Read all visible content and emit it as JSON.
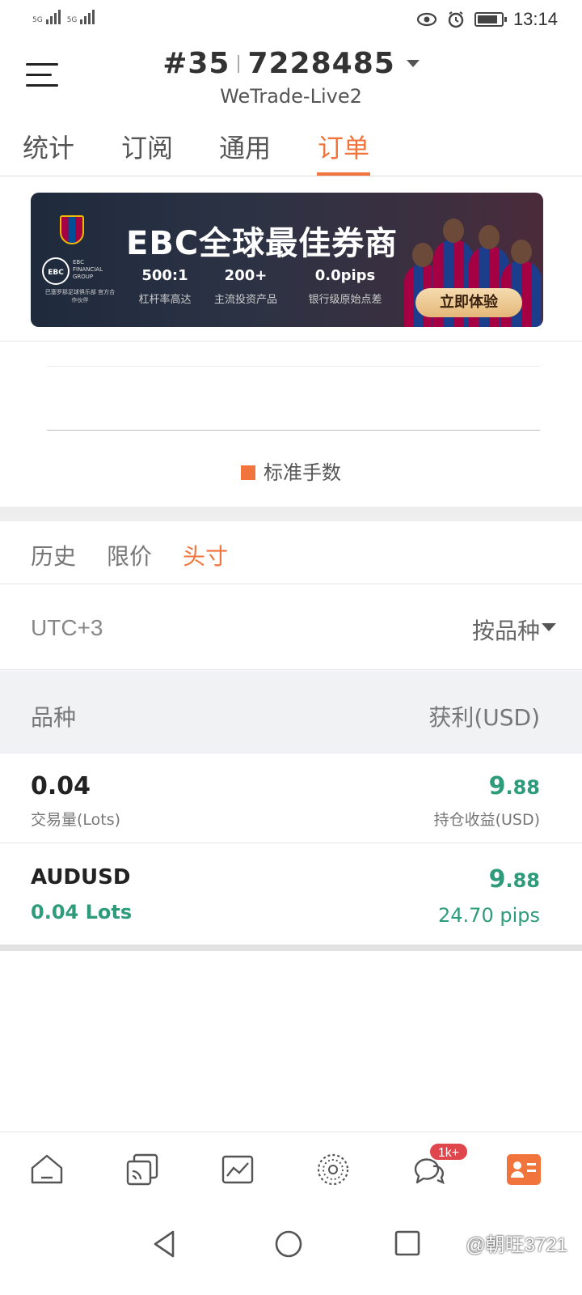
{
  "status_bar": {
    "sim1_label": "5G",
    "sim2_label": "5G",
    "time": "13:14",
    "battery_percent": 85
  },
  "header": {
    "account_prefix": "#35",
    "account_number": "7228485",
    "server": "WeTrade-Live2"
  },
  "top_tabs": [
    {
      "label": "统计",
      "active": false
    },
    {
      "label": "订阅",
      "active": false
    },
    {
      "label": "通用",
      "active": false
    },
    {
      "label": "订单",
      "active": true
    }
  ],
  "banner": {
    "logo_text": "EBC",
    "logo_sub": "EBC FINANCIAL GROUP",
    "partner_text": "巴塞罗那足球俱乐部 官方合作伙伴",
    "title": "EBC全球最佳券商",
    "stats": [
      {
        "value": "500:1",
        "label": "杠杆率高达"
      },
      {
        "value": "200+",
        "label": "主流投资产品"
      },
      {
        "value": "0.0pips",
        "label": "银行级原始点差"
      }
    ],
    "cta": "立即体验"
  },
  "chart": {
    "legend": "标准手数"
  },
  "sub_tabs": [
    {
      "label": "历史",
      "active": false
    },
    {
      "label": "限价",
      "active": false
    },
    {
      "label": "头寸",
      "active": true
    }
  ],
  "filter": {
    "timezone": "UTC+3",
    "sort_by": "按品种"
  },
  "table_head": {
    "left": "品种",
    "right": "获利(USD)"
  },
  "summary": {
    "volume": "0.04",
    "volume_label": "交易量(Lots)",
    "profit_int": "9",
    "profit_dec": ".88",
    "profit_label": "持仓收益(USD)"
  },
  "positions": [
    {
      "symbol": "AUDUSD",
      "lots": "0.04 Lots",
      "profit_int": "9",
      "profit_dec": ".88",
      "pips": "24.70 pips"
    }
  ],
  "bottom_nav": {
    "items": [
      "home-icon",
      "copy-trade-icon",
      "chart-icon",
      "community-icon",
      "chat-icon",
      "profile-card-icon"
    ],
    "chat_badge": "1k+",
    "active_color": "#f0743c"
  },
  "watermark": "@朝旺3721",
  "colors": {
    "accent": "#f0743c",
    "profit": "#2e9c7a"
  }
}
